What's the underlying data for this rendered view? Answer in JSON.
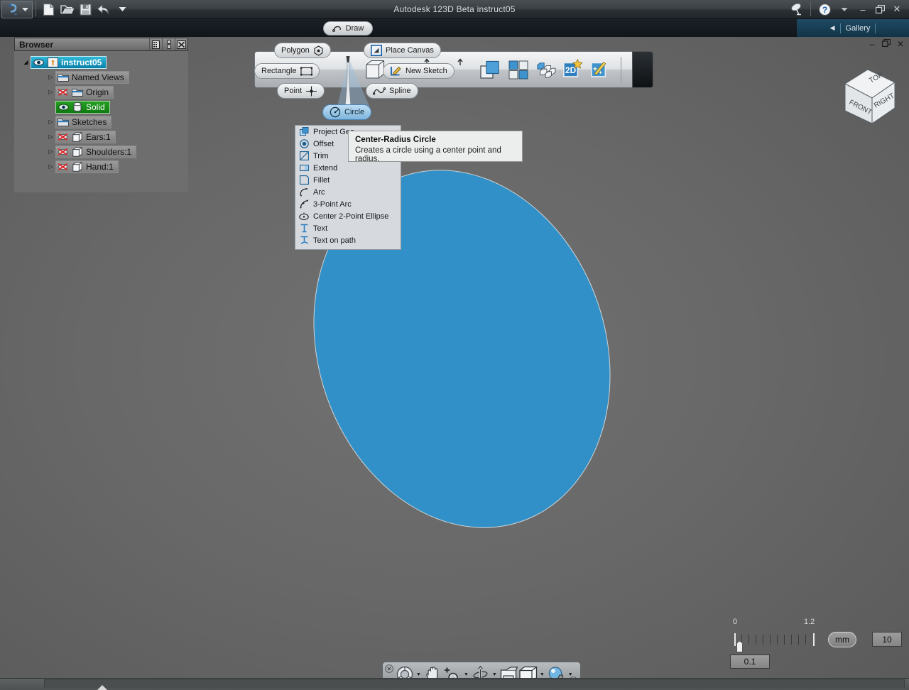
{
  "window": {
    "app_title": "Autodesk 123D Beta",
    "document_name": "instruct05",
    "title_full": "Autodesk 123D Beta    instruct05",
    "quick_access": [
      {
        "name": "app-menu-icon",
        "label": "123D"
      },
      {
        "name": "new-file-icon",
        "label": "New"
      },
      {
        "name": "open-file-icon",
        "label": "Open"
      },
      {
        "name": "save-file-icon",
        "label": "Save"
      },
      {
        "name": "undo-icon",
        "label": "Undo"
      },
      {
        "name": "customize-dropdown-icon",
        "label": "Customize"
      }
    ],
    "right_icons": [
      {
        "name": "satellite-icon",
        "label": "Connect"
      },
      {
        "name": "help-icon",
        "label": "Help"
      },
      {
        "name": "help-dropdown-icon",
        "label": "Help menu"
      }
    ],
    "controls": {
      "minimize": "–",
      "restore": "❐",
      "close": "✕"
    }
  },
  "tabs": {
    "draw": {
      "label": "Draw",
      "icon": "spline-icon",
      "active": true
    },
    "gallery": {
      "label": "Gallery",
      "collapse_icon": "◀"
    }
  },
  "document_window_controls": {
    "minimize": "–",
    "restore": "❐",
    "close": "✕"
  },
  "browser": {
    "title": "Browser",
    "header_buttons": [
      {
        "name": "browser-view-toggle-icon",
        "label": "View"
      },
      {
        "name": "browser-dock-icon",
        "label": "Dock"
      },
      {
        "name": "browser-close-icon",
        "label": "Close"
      }
    ],
    "tree": [
      {
        "label": "instruct05",
        "indent": 0,
        "twisty": "◢",
        "state": "selected-cyan",
        "icons": [
          "eye-icon",
          "assembly-icon"
        ]
      },
      {
        "label": "Named Views",
        "indent": 1,
        "twisty": "▷",
        "state": "normal",
        "icons": [
          "folder-icon"
        ]
      },
      {
        "label": "Origin",
        "indent": 1,
        "twisty": "▷",
        "state": "normal",
        "icons": [
          "eye-hidden-icon",
          "folder-icon"
        ]
      },
      {
        "label": "Solid",
        "indent": 1,
        "twisty": "",
        "state": "selected-green",
        "icons": [
          "eye-icon",
          "cylinder-icon"
        ]
      },
      {
        "label": "Sketches",
        "indent": 1,
        "twisty": "▷",
        "state": "normal",
        "icons": [
          "folder-icon"
        ]
      },
      {
        "label": "Ears:1",
        "indent": 1,
        "twisty": "▷",
        "state": "normal",
        "icons": [
          "eye-hidden-icon",
          "cube-icon"
        ]
      },
      {
        "label": "Shoulders:1",
        "indent": 1,
        "twisty": "▷",
        "state": "normal",
        "icons": [
          "eye-hidden-icon",
          "cube-icon"
        ]
      },
      {
        "label": "Hand:1",
        "indent": 1,
        "twisty": "▷",
        "state": "normal",
        "icons": [
          "eye-hidden-icon",
          "cube-icon"
        ]
      }
    ]
  },
  "draw_palette": {
    "buttons": [
      {
        "label": "Polygon",
        "icon": "polygon-icon",
        "active": false
      },
      {
        "label": "Rectangle",
        "icon": "rectangle-icon",
        "active": false
      },
      {
        "label": "Point",
        "icon": "point-icon",
        "active": false
      },
      {
        "label": "Circle",
        "icon": "circle-icon",
        "active": true
      },
      {
        "label": "Place Canvas",
        "icon": "place-canvas-icon",
        "active": false
      },
      {
        "label": "New Sketch",
        "icon": "new-sketch-icon",
        "active": false
      },
      {
        "label": "Spline",
        "icon": "spline-curve-icon",
        "active": false
      }
    ],
    "toolbar_icons": [
      {
        "name": "layers-icon",
        "label": "Layers"
      },
      {
        "name": "grid-view-icon",
        "label": "Grid View"
      },
      {
        "name": "blocks-icon",
        "label": "Blocks"
      },
      {
        "name": "2d-star-icon",
        "label": "2D"
      },
      {
        "name": "magic-wand-icon",
        "label": "Smart"
      }
    ]
  },
  "dropdown_menu": {
    "items": [
      {
        "label": "Project Geo",
        "icon": "project-geometry-icon"
      },
      {
        "label": "Offset",
        "icon": "offset-icon"
      },
      {
        "label": "Trim",
        "icon": "trim-icon"
      },
      {
        "label": "Extend",
        "icon": "extend-icon"
      },
      {
        "label": "Fillet",
        "icon": "fillet-icon"
      },
      {
        "label": "Arc",
        "icon": "arc-icon"
      },
      {
        "label": "3-Point Arc",
        "icon": "three-point-arc-icon"
      },
      {
        "label": "Center 2-Point Ellipse",
        "icon": "ellipse-icon"
      },
      {
        "label": "Text",
        "icon": "text-icon"
      },
      {
        "label": "Text on path",
        "icon": "text-on-path-icon"
      }
    ]
  },
  "tooltip": {
    "title": "Center-Radius Circle",
    "body": "Creates a circle using a center point and radius."
  },
  "viewcube": {
    "faces": {
      "top": "TOP",
      "front": "FRONT",
      "right": "RIGHT"
    }
  },
  "ruler": {
    "min_label": "0",
    "max_label": "1.2",
    "value": "0.1",
    "unit": "mm",
    "grid_value": "10"
  },
  "nav_toolbar": {
    "items": [
      {
        "name": "steering-wheel-icon",
        "label": "Steering Wheels",
        "arrow": true
      },
      {
        "name": "pan-hand-icon",
        "label": "Pan",
        "arrow": false
      },
      {
        "name": "zoom-icon",
        "label": "Zoom",
        "arrow": true
      },
      {
        "name": "orbit-icon",
        "label": "Orbit",
        "arrow": true
      },
      {
        "name": "fit-view-icon",
        "label": "Fit View",
        "arrow": false
      },
      {
        "name": "display-mode-icon",
        "label": "Display Mode",
        "arrow": true
      },
      {
        "name": "visual-style-icon",
        "label": "Visual Style",
        "arrow": true
      }
    ],
    "close_glyph": "✕",
    "minimize_glyph": "–"
  },
  "colors": {
    "sketch_fill": "#3090c7",
    "sketch_stroke": "#cfd4d7",
    "canvas_bg": "#646464",
    "selection_cyan": "#1696c4",
    "selection_green": "#18901b",
    "gallery_blue": "#1e4a63"
  }
}
